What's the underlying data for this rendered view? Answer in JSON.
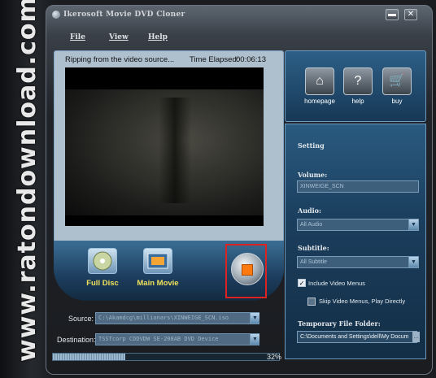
{
  "watermark": "www.ratondownload.com.br",
  "window": {
    "title": "Ikerosoft Movie DVD Cloner"
  },
  "menu": {
    "file": "File",
    "view": "View",
    "help": "Help"
  },
  "status": {
    "message": "Ripping from the video source...",
    "elapsed_label": "Time Elapsed:",
    "elapsed": "00:06:13"
  },
  "modes": {
    "full_disc": "Full Disc",
    "main_movie": "Main Movie"
  },
  "source": {
    "label": "Source:",
    "value": "C:\\Akamdcg\\millionars\\XINWEIGE_SCN.iso"
  },
  "destination": {
    "label": "Destination:",
    "value": "TSSTcorp CDDVDW SE-208AB DVD Device"
  },
  "progress": {
    "percent": 32,
    "percent_text": "32%"
  },
  "nav": {
    "homepage": "homepage",
    "help": "help",
    "buy": "buy"
  },
  "settings": {
    "title": "Setting",
    "volume_label": "Volume:",
    "volume_value": "XINWEIGE_SCN",
    "audio_label": "Audio:",
    "audio_value": "All Audio",
    "subtitle_label": "Subtitle:",
    "subtitle_value": "All Subtitle",
    "include_menus": "Include Video Menus",
    "include_menus_checked": true,
    "skip_menus": "Skip Video Menus, Play Directly",
    "skip_menus_checked": false,
    "temp_label": "Temporary File Folder:",
    "temp_value": "C:\\Documents and Settings\\dell\\My Docum"
  },
  "colors": {
    "accent": "#ff7a0e",
    "highlight_border": "#d22222",
    "mode_label": "#f0e15a"
  }
}
